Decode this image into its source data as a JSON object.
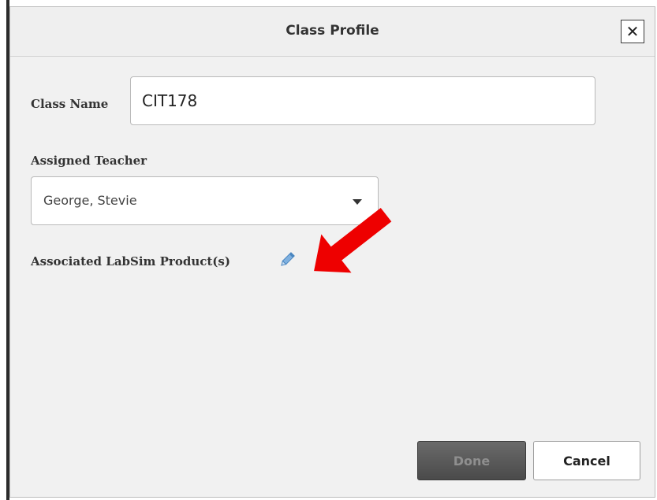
{
  "dialog": {
    "title": "Class Profile",
    "close_glyph": "✕",
    "close_icon": "close-icon"
  },
  "form": {
    "class_name_label": "Class Name",
    "class_name_value": "CIT178",
    "teacher_label": "Assigned Teacher",
    "teacher_value": "George, Stevie",
    "products_label": "Associated LabSim Product(s)",
    "products_edit_icon": "pencil-icon"
  },
  "footer": {
    "done_label": "Done",
    "cancel_label": "Cancel"
  },
  "annotation": {
    "arrow_color": "#ee0000",
    "arrow_icon": "red-arrow-icon"
  },
  "colors": {
    "dialog_background": "#f1f1f1",
    "done_background": "#4f4f4f",
    "pencil": "#5b9bd5"
  }
}
